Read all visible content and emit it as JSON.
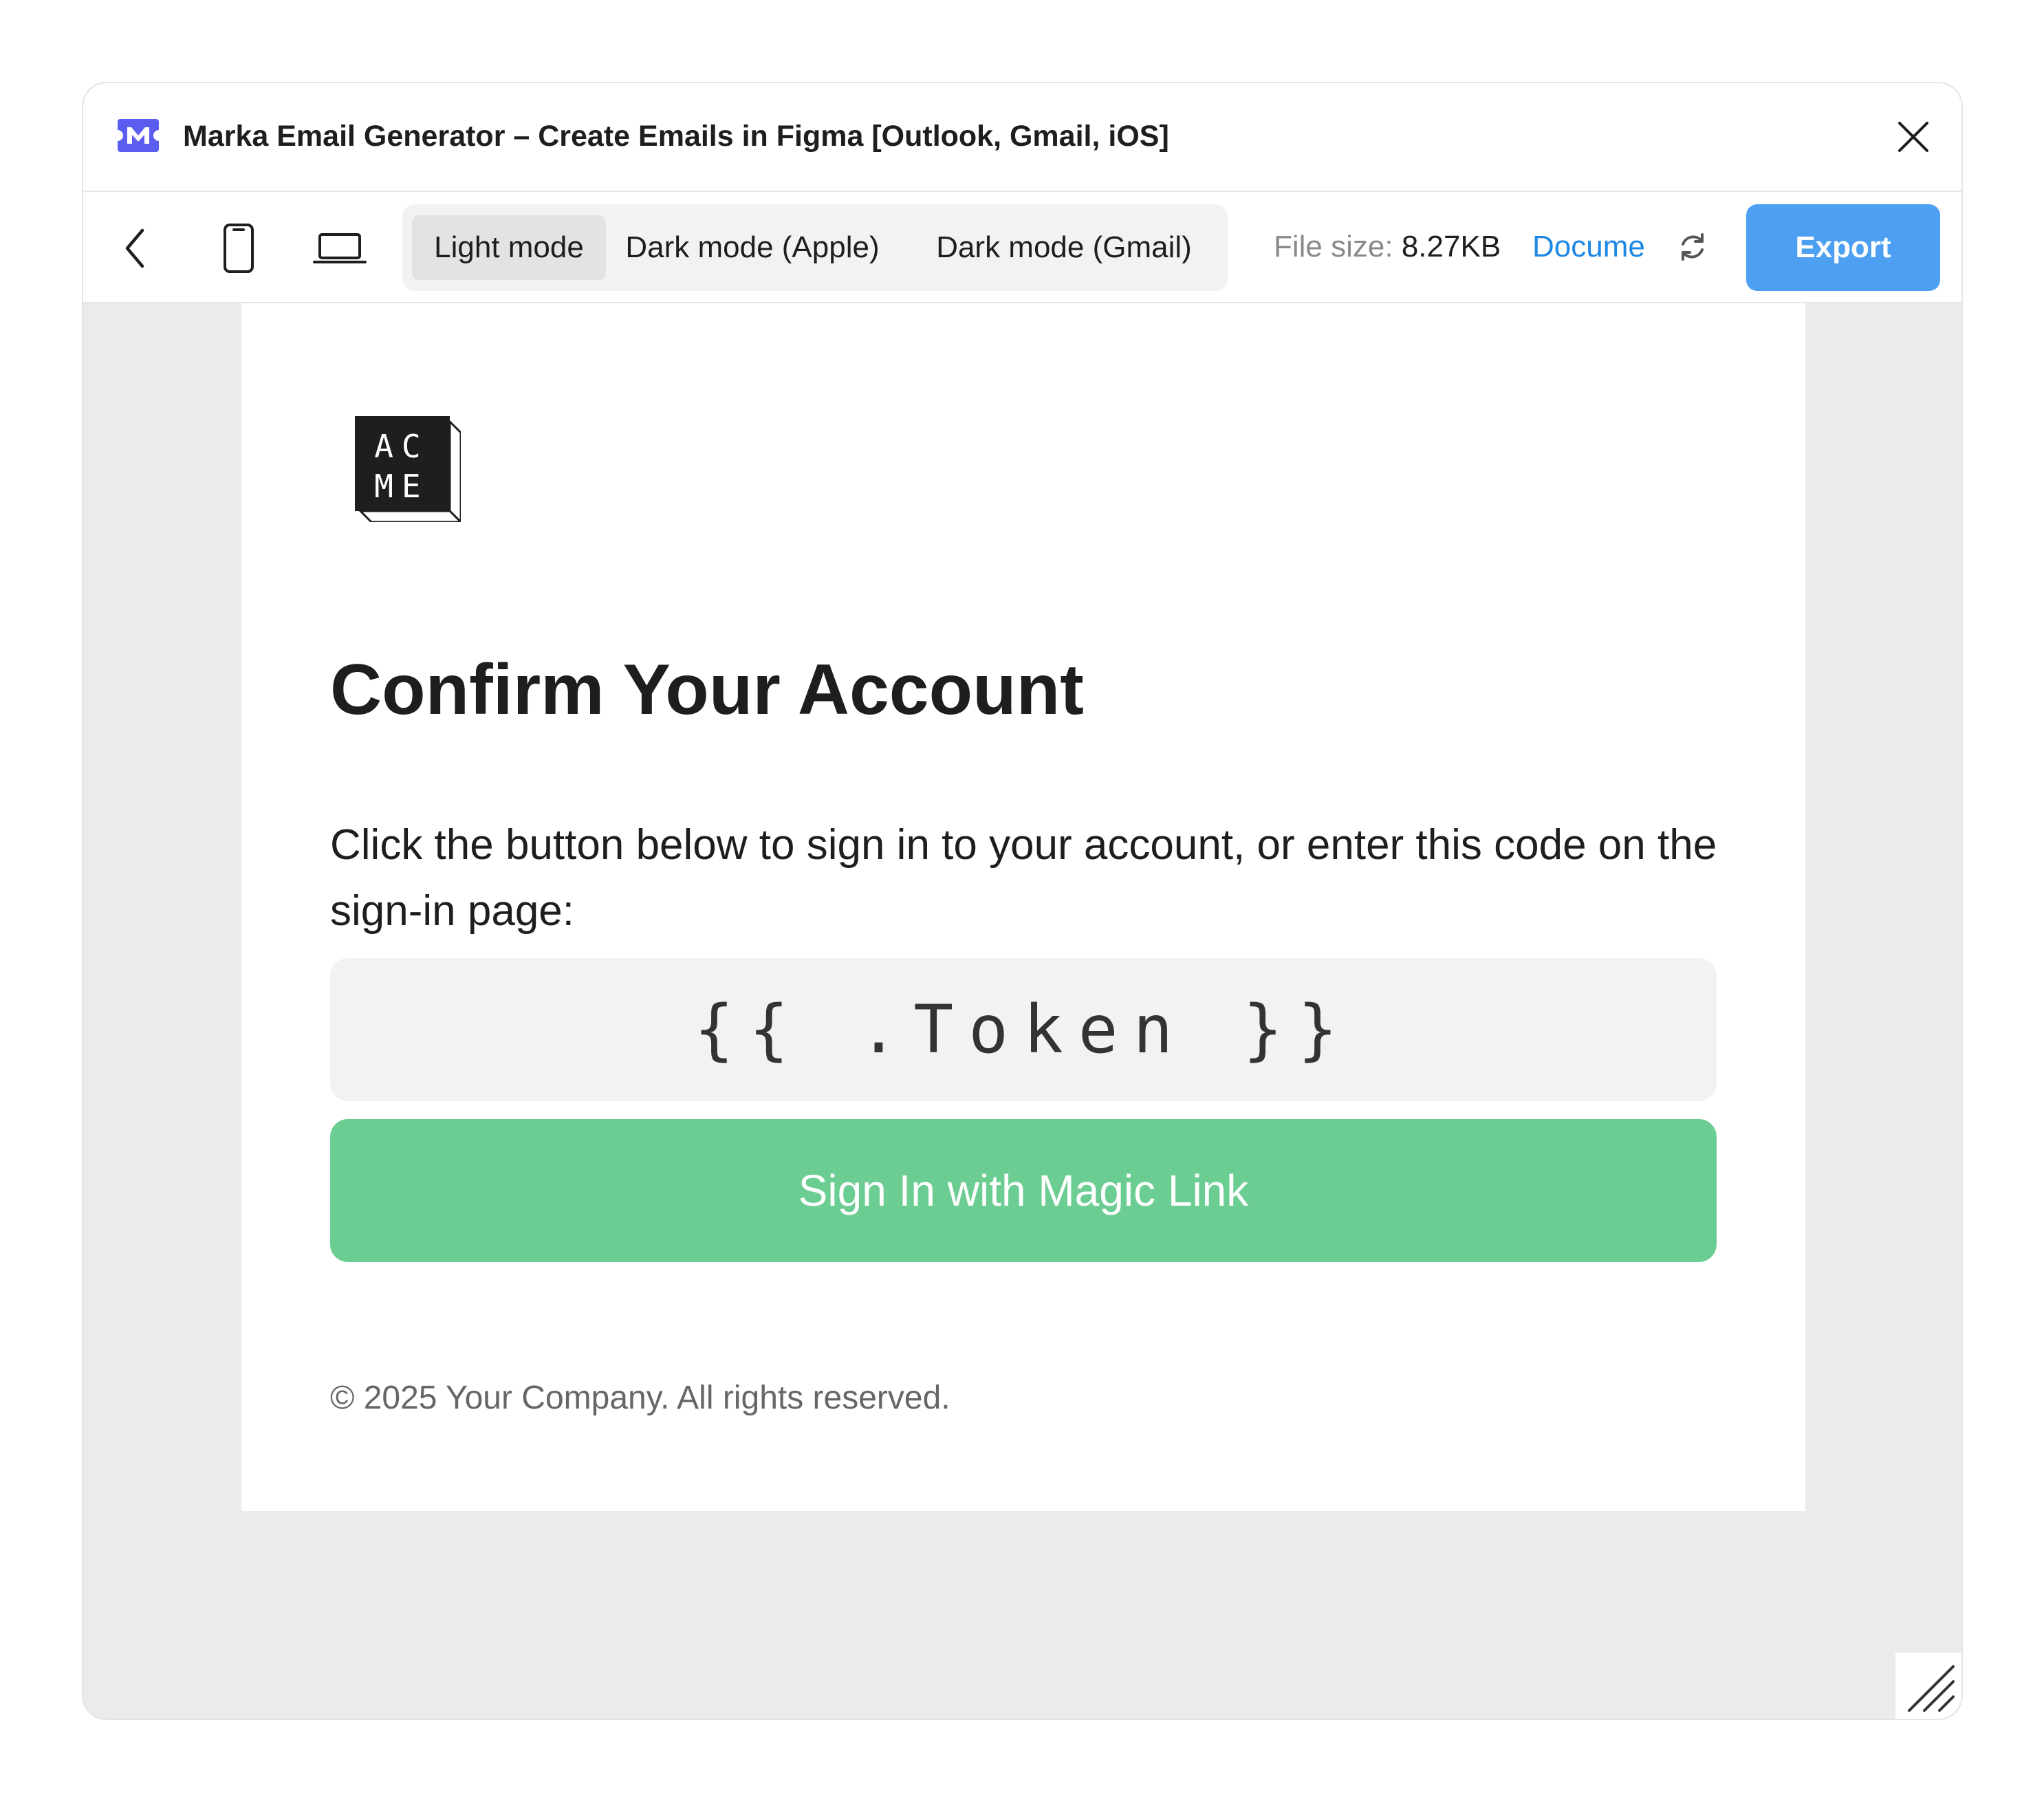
{
  "window": {
    "title": "Marka Email Generator – Create Emails in Figma [Outlook, Gmail, iOS]",
    "app_icon": "marka-logo-icon",
    "close_icon": "close-icon"
  },
  "toolbar": {
    "back_icon": "chevron-left-icon",
    "mobile_icon": "mobile-device-icon",
    "desktop_icon": "laptop-icon",
    "modes": [
      {
        "label": "Light mode",
        "active": true
      },
      {
        "label": "Dark mode (Apple)",
        "active": false
      },
      {
        "label": "Dark mode (Gmail)",
        "active": false
      }
    ],
    "file_size_label": "File size:",
    "file_size_value": "8.27KB",
    "docs_link": "Docume",
    "refresh_icon": "refresh-icon",
    "export_label": "Export",
    "accent_color": "#4c9ff1"
  },
  "email": {
    "logo_text": [
      "AC",
      "ME"
    ],
    "heading": "Confirm Your Account",
    "body": "Click the button below to sign in to your account, or enter this code on the sign-in page:",
    "token": "{{ .Token }}",
    "button_label": "Sign In with Magic Link",
    "button_color": "#6ccd92",
    "footer": "© 2025 Your Company. All rights reserved."
  },
  "resize_icon": "resize-handle-icon"
}
